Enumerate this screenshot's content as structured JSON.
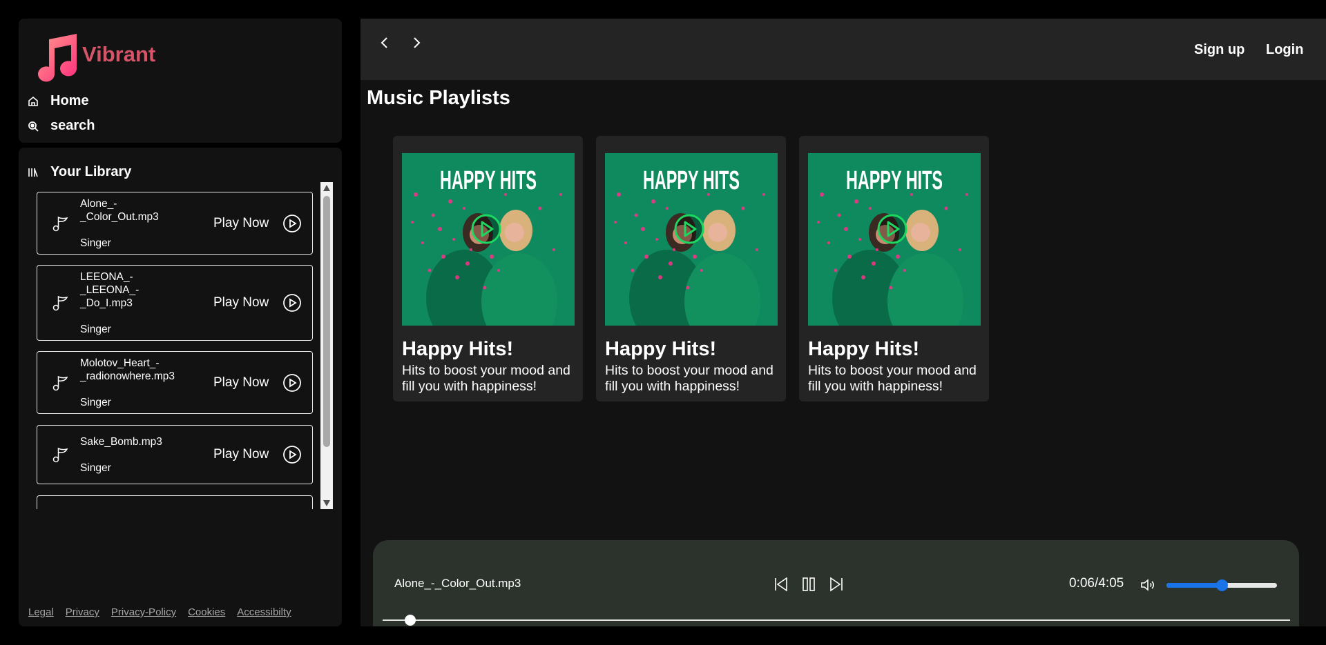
{
  "brand": {
    "name": "Vibrant",
    "accent": "#d65468"
  },
  "nav": {
    "home_label": "Home",
    "search_label": "search"
  },
  "library": {
    "title": "Your Library",
    "items": [
      {
        "name": "Alone_-\n_Color_Out.mp3",
        "artist": "Singer",
        "action": "Play Now"
      },
      {
        "name": "LEEONA_-\n_LEEONA_-\n_Do_I.mp3",
        "artist": "Singer",
        "action": "Play Now"
      },
      {
        "name": "Molotov_Heart_-\n_radionowhere.mp3",
        "artist": "Singer",
        "action": "Play Now"
      },
      {
        "name": "Sake_Bomb.mp3",
        "artist": "Singer",
        "action": "Play Now"
      }
    ]
  },
  "footer": {
    "links": [
      "Legal",
      "Privacy",
      "Privacy-Policy",
      "Cookies",
      "Accessibilty"
    ]
  },
  "header": {
    "signup_label": "Sign up",
    "login_label": "Login"
  },
  "main": {
    "title": "Music Playlists",
    "playlists": [
      {
        "cover_text": "HAPPY HITS",
        "title": "Happy Hits!",
        "description": "Hits to boost your mood and fill you with happiness!"
      },
      {
        "cover_text": "HAPPY HITS",
        "title": "Happy Hits!",
        "description": "Hits to boost your mood and fill you with happiness!"
      },
      {
        "cover_text": "HAPPY HITS",
        "title": "Happy Hits!",
        "description": "Hits to boost your mood and fill you with happiness!"
      }
    ]
  },
  "player": {
    "track": "Alone_-_Color_Out.mp3",
    "time": "0:06/4:05",
    "progress_fraction": 0.024,
    "volume_fraction": 0.5,
    "accent": "#1a73e8"
  },
  "icons": {
    "cover_play": "play-circle-icon",
    "ring_color": "#1ed760"
  }
}
